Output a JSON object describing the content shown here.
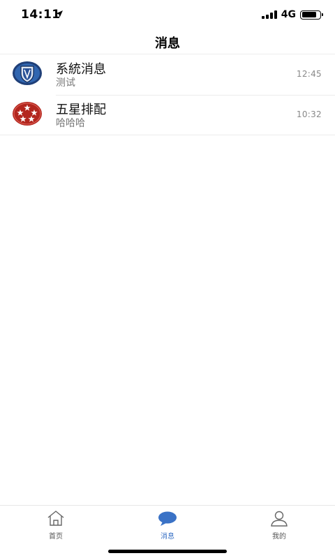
{
  "status_bar": {
    "time": "14:11",
    "network": "4G",
    "battery_level": 0.8
  },
  "header": {
    "title": "消息"
  },
  "messages": [
    {
      "name": "系統消息",
      "preview": "测试",
      "time": "12:45",
      "avatar": "shield-icon"
    },
    {
      "name": "五星排配",
      "preview": "哈哈哈",
      "time": "10:32",
      "avatar": "five-stars-icon"
    }
  ],
  "tab_bar": {
    "tabs": [
      {
        "label": "首页",
        "icon": "home-icon",
        "active": false
      },
      {
        "label": "消息",
        "icon": "chat-bubble-icon",
        "active": true
      },
      {
        "label": "我的",
        "icon": "person-icon",
        "active": false
      }
    ]
  },
  "colors": {
    "accent": "#3a72c6",
    "shield_bg": "#1f3f78",
    "stars_bg": "#b3261e"
  }
}
